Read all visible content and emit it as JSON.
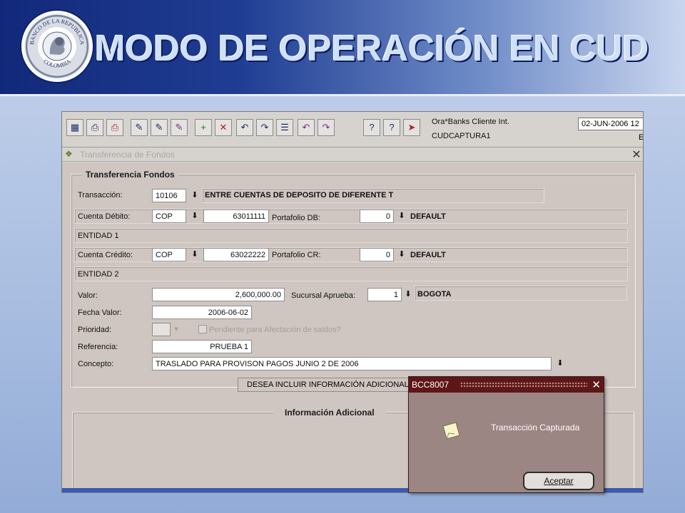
{
  "slide": {
    "title": "MODO DE OPERACIÓN EN CUD",
    "logo_text_top": "BANCO DE LA REPUBLICA",
    "logo_text_bottom": "COLOMBIA"
  },
  "toolbar": {
    "app_name": "Ora*Banks Cliente Int.",
    "user": "CUDCAPTURA1",
    "date": "02-JUN-2006 12",
    "corner": "E",
    "icons": [
      "save-icon",
      "print-icon",
      "print-preview-icon",
      "edit-icon",
      "edit-note-icon",
      "highlight-icon",
      "new-record-icon",
      "delete-record-icon",
      "previous-icon",
      "next-icon",
      "list-icon",
      "previous-block-icon",
      "next-block-icon",
      "help-icon",
      "question-icon",
      "exit-icon"
    ]
  },
  "window": {
    "title": "Transferencia de Fondos"
  },
  "form": {
    "group_title": "Transferencia Fondos",
    "transaccion_label": "Transacción:",
    "transaccion_code": "10106",
    "transaccion_desc": "ENTRE CUENTAS DE DEPOSITO DE DIFERENTE T",
    "cuenta_debito_label": "Cuenta Débito:",
    "debito_moneda": "COP",
    "debito_cuenta": "63011111",
    "portafolio_db_label": "Portafolio DB:",
    "portafolio_db_value": "0",
    "portafolio_db_desc": "DEFAULT",
    "entidad1": "ENTIDAD 1",
    "cuenta_credito_label": "Cuenta Crédito:",
    "credito_moneda": "COP",
    "credito_cuenta": "63022222",
    "portafolio_cr_label": "Portafolio CR:",
    "portafolio_cr_value": "0",
    "portafolio_cr_desc": "DEFAULT",
    "entidad2": "ENTIDAD 2",
    "valor_label": "Valor:",
    "valor": "2,600,000.00",
    "sucursal_label": "Sucursal Aprueba:",
    "sucursal_value": "1",
    "sucursal_desc": "BOGOTA",
    "fecha_valor_label": "Fecha Valor:",
    "fecha_valor": "2006-06-02",
    "prioridad_label": "Prioridad:",
    "pendiente_label": "Pendiente para Afectación de saldos?",
    "referencia_label": "Referencia:",
    "referencia": "PRUEBA 1",
    "concepto_label": "Concepto:",
    "concepto": "TRASLADO PARA PROVISON PAGOS JUNIO 2 DE 2006",
    "info_adicional_button": "DESEA INCLUIR INFORMACIÓN ADICIONAL",
    "info_adicional_title": "Información Adicional"
  },
  "dialog": {
    "title": "BCC8007",
    "message": "Transacción Capturada",
    "accept": "Aceptar"
  }
}
